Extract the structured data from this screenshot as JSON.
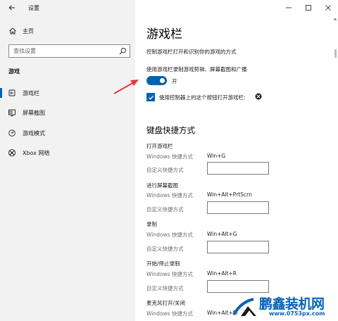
{
  "window": {
    "title": "设置"
  },
  "sidebar": {
    "home_label": "主页",
    "search_placeholder": "查找设置",
    "section": "游戏",
    "items": [
      {
        "label": "游戏栏",
        "icon": "game-bar-icon",
        "selected": true
      },
      {
        "label": "屏幕截图",
        "icon": "screenshot-icon",
        "selected": false
      },
      {
        "label": "游戏模式",
        "icon": "game-mode-icon",
        "selected": false
      },
      {
        "label": "Xbox 网络",
        "icon": "xbox-icon",
        "selected": false
      }
    ]
  },
  "main": {
    "title": "游戏栏",
    "description": "控制游戏栏打开和识别你的游戏的方式",
    "toggle": {
      "label": "使用游戏栏录制游戏剪辑、屏幕截图和广播",
      "state_text": "开",
      "on": true
    },
    "checkbox": {
      "label": "使用控制器上的这个按钮打开游戏栏:",
      "checked": true
    },
    "shortcuts_heading": "键盘快捷方式",
    "key_label": "Windows 快捷方式",
    "custom_label": "自定义快捷方式",
    "shortcuts": [
      {
        "title": "打开游戏栏",
        "win": "Win+G"
      },
      {
        "title": "进行屏幕截图",
        "win": "Win+Alt+PrtScrn"
      },
      {
        "title": "录制",
        "win": "Win+Alt+G"
      },
      {
        "title": "开始/停止录制",
        "win": "Win+Alt+R"
      },
      {
        "title": "麦克风打开/关闭",
        "win": "Win+Alt+M"
      }
    ]
  },
  "watermark": {
    "name": "鹏鑫装机网",
    "url": "www.0753px.com"
  },
  "colors": {
    "accent": "#0063b1",
    "sidebar_bg": "#f2f2f2",
    "arrow": "#e8353a",
    "watermark": "#0a63b6"
  }
}
